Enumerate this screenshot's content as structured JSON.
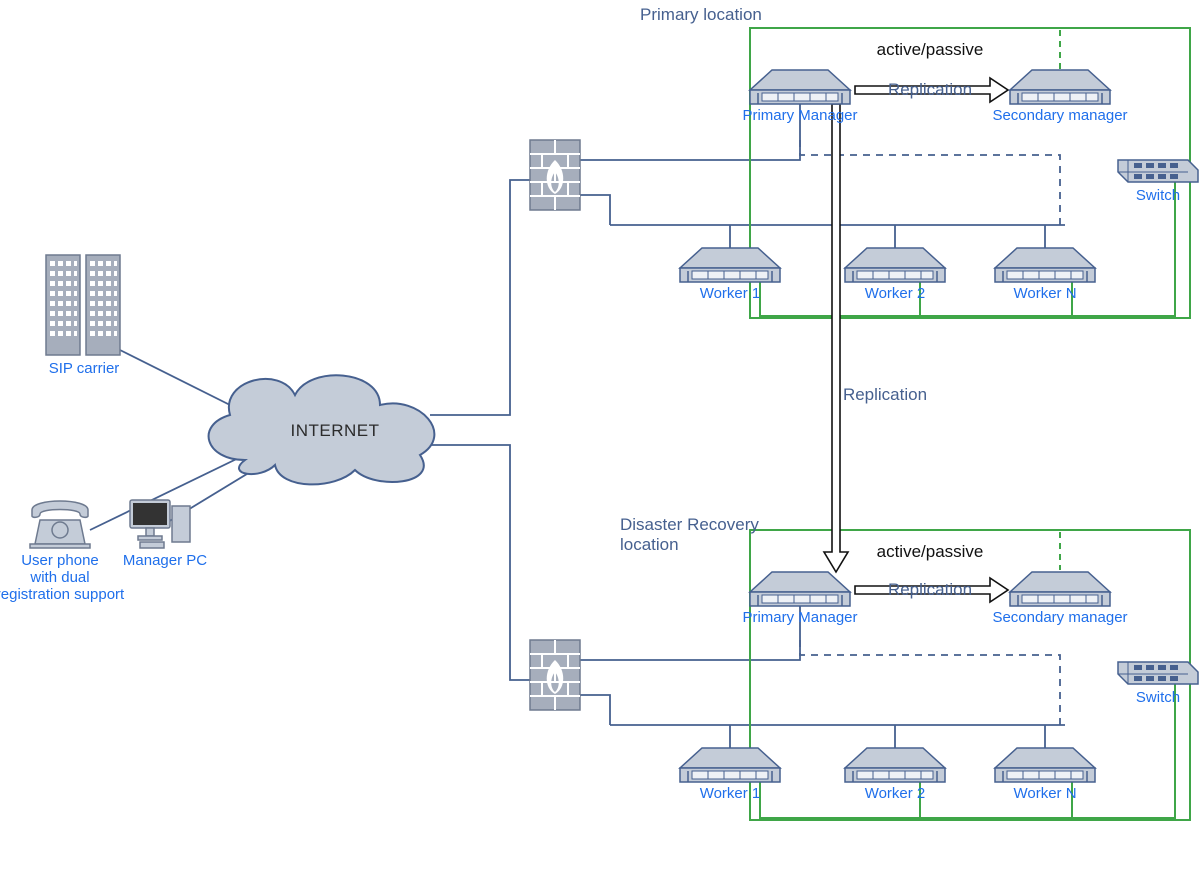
{
  "labels": {
    "internet": "INTERNET",
    "sip_carrier": "SIP carrier",
    "user_phone_l1": "User phone",
    "user_phone_l2": "with dual",
    "user_phone_l3": "registration support",
    "manager_pc": "Manager PC",
    "primary_location": "Primary location",
    "dr_location_l1": "Disaster Recovery",
    "dr_location_l2": "location",
    "active_passive": "active/passive",
    "replication": "Replication",
    "primary_manager": "Primary Manager",
    "secondary_manager": "Secondary manager",
    "switch": "Switch",
    "worker_1": "Worker 1",
    "worker_2": "Worker 2",
    "worker_n": "Worker N"
  },
  "colors": {
    "line": "#46608F",
    "green": "#3FA648",
    "fill_light": "#C4CCD8",
    "fill_dark": "#A6AEBC",
    "icon_stroke": "#6E7A8F"
  }
}
